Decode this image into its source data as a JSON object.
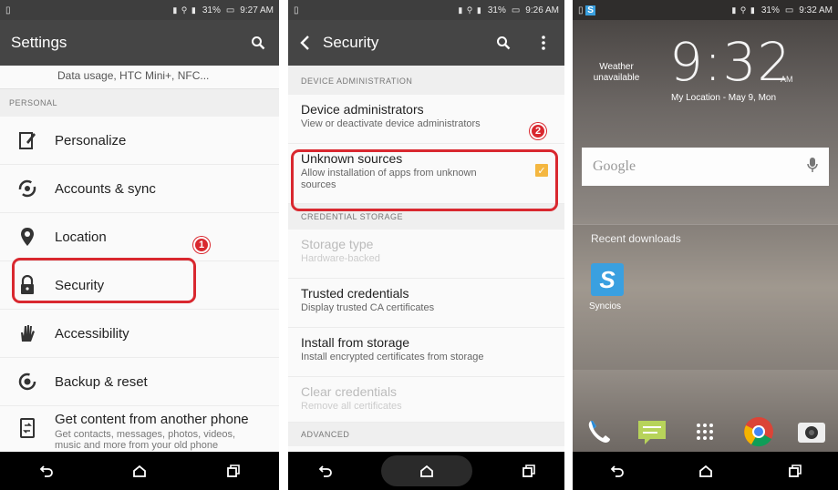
{
  "colors": {
    "highlight": "#d9282f",
    "checkbox": "#f4b740",
    "actionbar": "#454545",
    "syncios": "#3aa0e0"
  },
  "screen1": {
    "status_time": "9:27 AM",
    "battery": "31%",
    "title": "Settings",
    "top_partial": "Data usage, HTC Mini+, NFC...",
    "section_personal": "PERSONAL",
    "items": [
      {
        "label": "Personalize",
        "icon": "personalize-icon"
      },
      {
        "label": "Accounts & sync",
        "icon": "sync-icon"
      },
      {
        "label": "Location",
        "icon": "location-pin-icon"
      },
      {
        "label": "Security",
        "icon": "lock-icon"
      },
      {
        "label": "Accessibility",
        "icon": "hand-icon"
      },
      {
        "label": "Backup & reset",
        "icon": "backup-icon"
      }
    ],
    "transfer": {
      "label": "Get content from another phone",
      "sub": "Get contacts, messages, photos, videos, music and more from your old phone"
    },
    "step_badge": "1"
  },
  "screen2": {
    "status_time": "9:26 AM",
    "battery": "31%",
    "title": "Security",
    "section_device": "DEVICE ADMINISTRATION",
    "device_admins": {
      "title": "Device administrators",
      "desc": "View or deactivate device administrators"
    },
    "unknown_sources": {
      "title": "Unknown sources",
      "desc": "Allow installation of apps from unknown sources",
      "checked": true
    },
    "section_credential": "CREDENTIAL STORAGE",
    "storage_type": {
      "title": "Storage type",
      "desc": "Hardware-backed"
    },
    "trusted": {
      "title": "Trusted credentials",
      "desc": "Display trusted CA certificates"
    },
    "install": {
      "title": "Install from storage",
      "desc": "Install encrypted certificates from storage"
    },
    "clear": {
      "title": "Clear credentials",
      "desc": "Remove all certificates"
    },
    "section_advanced": "ADVANCED",
    "step_badge": "2"
  },
  "screen3": {
    "status_time": "9:32 AM",
    "battery": "31%",
    "clock": "9:32",
    "ampm": "AM",
    "weather": "Weather unavailable",
    "location_date": "My Location - May 9, Mon",
    "search_label": "Google",
    "recent_label": "Recent downloads",
    "app_letter": "S",
    "app_name": "Syncios"
  }
}
